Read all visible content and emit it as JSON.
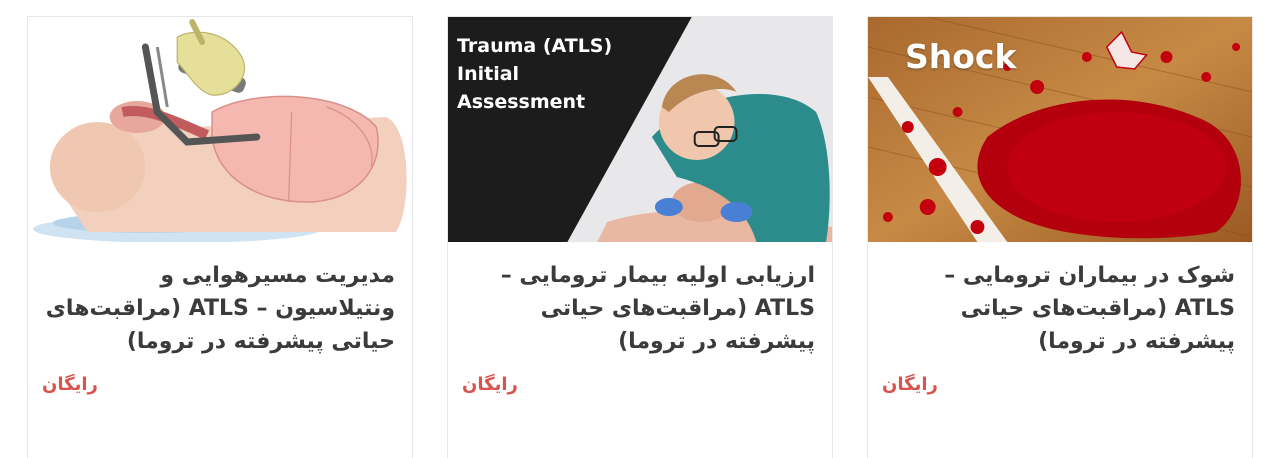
{
  "courses": [
    {
      "thumbnail_caption": "",
      "title": "مدیریت مسیرهوایی و ونتیلاسیون – ATLS (مراقبت‌های حیاتی پیشرفته در تروما)",
      "price": "رایگان"
    },
    {
      "thumbnail_caption": "Trauma (ATLS)\nInitial\nAssessment",
      "title": "ارزیابی اولیه بیمار ترومایی – ATLS (مراقبت‌های حیاتی پیشرفته در تروما)",
      "price": "رایگان"
    },
    {
      "thumbnail_caption": "Shock",
      "title": "شوک در بیماران ترومایی – ATLS (مراقبت‌های حیاتی پیشرفته در تروما)",
      "price": "رایگان"
    }
  ],
  "colors": {
    "title": "#3b3b3b",
    "price": "#d9534f",
    "card_border": "#e6e6e6"
  }
}
